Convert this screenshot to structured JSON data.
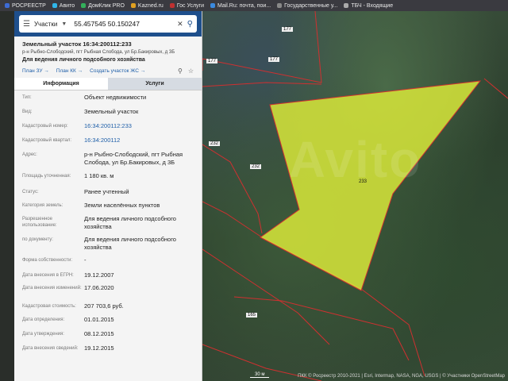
{
  "bookmarks": [
    {
      "label": "РОСРЕЕСТР",
      "color": "#3d6bd6"
    },
    {
      "label": "Авито",
      "color": "#2fb6e8"
    },
    {
      "label": "ДомКлик PRO",
      "color": "#33b05a"
    },
    {
      "label": "Kazned.ru",
      "color": "#e0a020"
    },
    {
      "label": "Гос Услуги",
      "color": "#c03030"
    },
    {
      "label": "Mail.Ru: почта, пои...",
      "color": "#3a8ae0"
    },
    {
      "label": "Государственные у...",
      "color": "#888888"
    },
    {
      "label": "ТБЧ - Входящие",
      "color": "#aaaaaa"
    }
  ],
  "search": {
    "type_label": "Участки",
    "query": "55.457545 50.150247"
  },
  "object": {
    "title": "Земельный участок 16:34:200112:233",
    "address": "р-н Рыбно-Слободский, пгт Рыбная Слобода, ул Бр.Бакировых, д 3Б",
    "purpose": "Для ведения личного подсобного хозяйства"
  },
  "links": [
    "План ЗУ →",
    "План КК →",
    "Создать участок ЖС →"
  ],
  "tabs": [
    "Информация",
    "Услуги"
  ],
  "rows": [
    {
      "label": "Тип:",
      "value": "Объект недвижимости",
      "h": 18
    },
    {
      "label": "Вид:",
      "value": "Земельный участок",
      "h": 18
    },
    {
      "label": "Кадастровый номер:",
      "value": "16:34:200112:233",
      "link": true,
      "h": 18
    },
    {
      "label": "Кадастровый квартал:",
      "value": "16:34:200112",
      "link": true,
      "h": 18
    },
    {
      "label": "Адрес:",
      "value": "р-н Рыбно-Слободский, пгт Рыбная Слобода, ул Бр.Бакировых, д 3Б",
      "h": 27
    },
    {
      "label": "Площадь уточненная:",
      "value": "1 180 кв. м",
      "h": 20
    },
    {
      "label": "Статус:",
      "value": "Ранее учтенный",
      "h": 17
    },
    {
      "label": "Категория земель:",
      "value": "Земли населённых пунктов",
      "h": 17
    },
    {
      "label": "Разрешенное использование:",
      "value": "Для ведения личного подсобного хозяйства",
      "h": 26
    },
    {
      "label": "по документу:",
      "value": "Для ведения личного подсобного хозяйства",
      "h": 26
    },
    {
      "label": "Форма собственности:",
      "value": "-",
      "h": 19
    },
    {
      "label": "Дата внесения в ЕГРН:",
      "value": "19.12.2007",
      "h": 16
    },
    {
      "label": "Дата внесения изменений:",
      "value": "17.06.2020",
      "h": 23
    },
    {
      "label": "Кадастровая стоимость:",
      "value": "207 703,6 руб.",
      "h": 17
    },
    {
      "label": "Дата определения:",
      "value": "01.01.2015",
      "h": 18
    },
    {
      "label": "Дата утверждения:",
      "value": "08.12.2015",
      "h": 18
    },
    {
      "label": "Дата внесения сведений:",
      "value": "19.12.2015",
      "h": 18
    }
  ],
  "map": {
    "parcel_labels": [
      "177",
      "177",
      "177",
      "232",
      "232",
      "233",
      "165"
    ],
    "parcel_color": "#d8e83a",
    "boundary_color": "#d03030",
    "scale": "30 м",
    "credit": "ПКК © Росреестр 2010-2021 | Esri, Intermap, NASA, NGA, USGS | © Участники OpenStreetMap",
    "watermark": "Avito"
  }
}
